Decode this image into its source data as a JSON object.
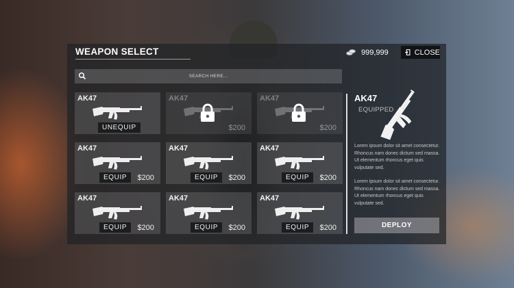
{
  "header": {
    "title": "WEAPON SELECT",
    "currency_amount": "999,999",
    "close_label": "CLOSE"
  },
  "search": {
    "placeholder": "SEARCH HERE..."
  },
  "weapons": [
    {
      "name": "AK47",
      "locked": false,
      "action": "UNEQUIP",
      "price": ""
    },
    {
      "name": "AK47",
      "locked": true,
      "action": "",
      "price": "$200"
    },
    {
      "name": "AK47",
      "locked": true,
      "action": "",
      "price": "$200"
    },
    {
      "name": "AK47",
      "locked": false,
      "action": "EQUIP",
      "price": "$200"
    },
    {
      "name": "AK47",
      "locked": false,
      "action": "EQUIP",
      "price": "$200"
    },
    {
      "name": "AK47",
      "locked": false,
      "action": "EQUIP",
      "price": "$200"
    },
    {
      "name": "AK47",
      "locked": false,
      "action": "EQUIP",
      "price": "$200"
    },
    {
      "name": "AK47",
      "locked": false,
      "action": "EQUIP",
      "price": "$200"
    },
    {
      "name": "AK47",
      "locked": false,
      "action": "EQUIP",
      "price": "$200"
    }
  ],
  "detail": {
    "name": "AK47",
    "status": "EQUIPPED",
    "description_1": "Lorem ipsum dolor sit amet consectetur. Rhoncus nam donec dictum sed massa. Ut elementum rhoncus eget quis vulputate sed.",
    "description_2": "Lorem ipsum dolor sit amet consectetur. Rhoncus nam donec dictum sed massa. Ut elementum rhoncus eget quis vulputate sed.",
    "deploy_label": "DEPLOY"
  },
  "icons": {
    "weapon": "rifle-icon",
    "lock": "lock-icon",
    "currency": "coin-stack-icon",
    "close": "exit-door-icon",
    "search": "search-icon"
  }
}
